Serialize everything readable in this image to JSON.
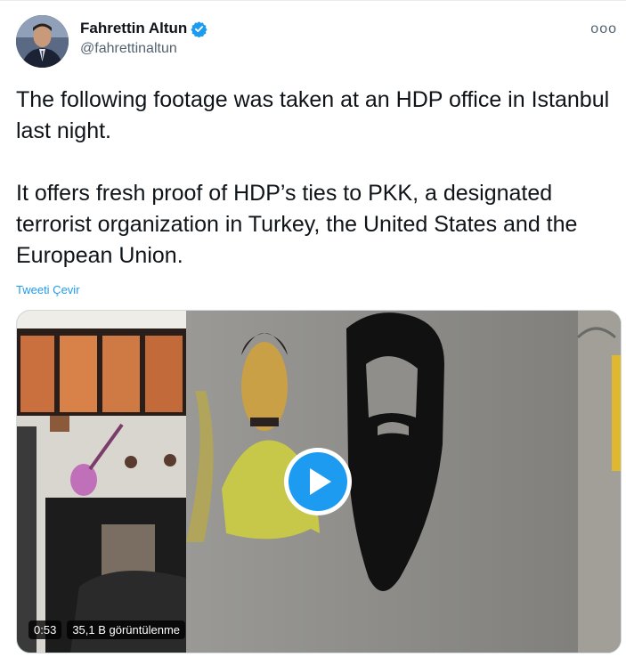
{
  "author": {
    "display_name": "Fahrettin Altun",
    "handle": "@fahrettinaltun",
    "verified_icon": "verified-badge-icon",
    "avatar_icon": "avatar"
  },
  "menu": {
    "more_label": "ooo"
  },
  "tweet": {
    "text": "The following footage was taken at an HDP office in Istanbul last night.\n\nIt offers fresh proof of HDP’s ties to PKK, a designated terrorist organization in Turkey, the United States and the European Union.",
    "translate_label": "Tweeti Çevir"
  },
  "video": {
    "duration": "0:53",
    "views": "35,1 B görüntülenme",
    "play_icon": "play-icon"
  },
  "colors": {
    "accent": "#1d9bf0",
    "text": "#0f1419",
    "secondary": "#536471"
  }
}
